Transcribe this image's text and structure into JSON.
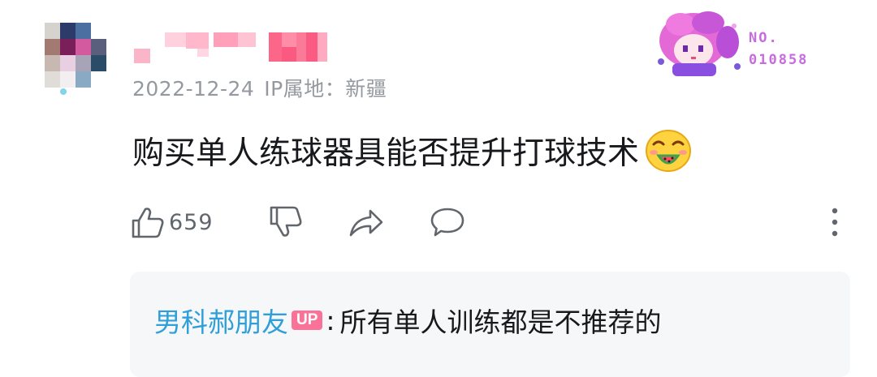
{
  "comment": {
    "meta": {
      "date": "2022-12-24",
      "ip_location": "IP属地：新疆"
    },
    "fan_badge": {
      "label": "NO.",
      "number": "010858",
      "icon": "anime-character-badge-icon"
    },
    "text": "购买单人练球器具能否提升打球技术",
    "emoji": "greedy-face-emoji-icon",
    "actions": {
      "like_icon": "thumbs-up-icon",
      "like_count": "659",
      "dislike_icon": "thumbs-down-icon",
      "share_icon": "share-arrow-icon",
      "reply_icon": "comment-bubble-icon",
      "more_icon": "more-vertical-icon"
    },
    "reply_preview": {
      "author": "男科郝朋友",
      "badge": "UP",
      "separator": ":",
      "content": "所有单人训练都是不推荐的"
    }
  },
  "colors": {
    "meta_gray": "#9499a0",
    "author_blue": "#2f9fd9",
    "up_pink": "#fb7299",
    "badge_purple": "#c86be0",
    "reply_bg": "#f6f7f8"
  }
}
